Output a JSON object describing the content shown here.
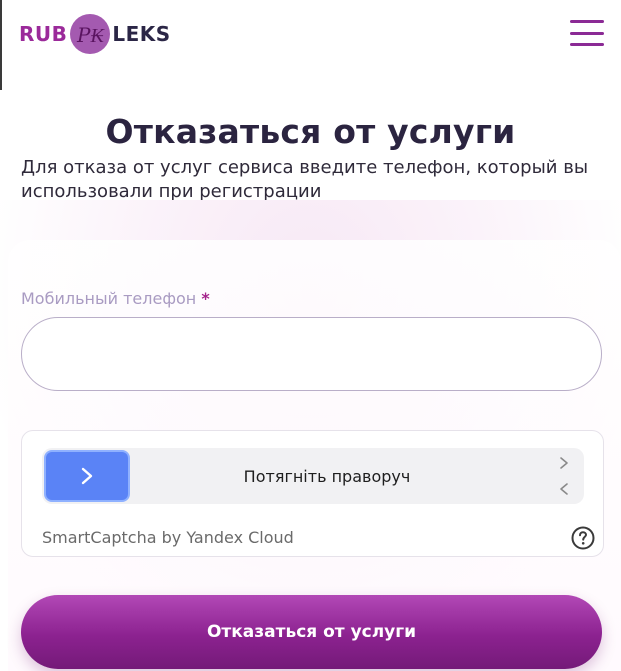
{
  "header": {
    "logo_left": "RUB",
    "logo_mark": "Р₭",
    "logo_right": "LEKS",
    "menu_icon": "hamburger-menu-icon"
  },
  "page": {
    "title": "Отказаться от услуги",
    "subtitle": "Для отказа от услуг сервиса введите телефон, который вы использовали при регистрации"
  },
  "form": {
    "phone_label": "Мобильный телефон",
    "required_mark": "*",
    "phone_value": "",
    "phone_placeholder": ""
  },
  "captcha": {
    "slider_text": "Потягніть праворуч",
    "brand": "SmartCaptcha by Yandex Cloud",
    "handle_icon": "chevron-right-icon",
    "help_icon": "question-circle-icon"
  },
  "submit": {
    "label": "Отказаться от услуги"
  },
  "colors": {
    "brand_purple": "#8c2290",
    "title": "#2b2440",
    "slider_handle": "#5a83f6"
  }
}
